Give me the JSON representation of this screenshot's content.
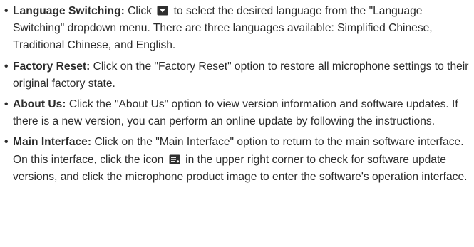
{
  "items": [
    {
      "term": "Language Switching:",
      "before_icon": "Click",
      "icon": "dropdown-square-icon",
      "after_icon": "to select the desired language from the \"Language Switching\" dropdown menu. There are three languages available: Simplified Chinese, Traditional Chinese, and English."
    },
    {
      "term": "Factory Reset:",
      "text": "Click on the \"Factory Reset\" option to restore all microphone settings to their original factory state."
    },
    {
      "term": "About Us:",
      "text": "Click the \"About Us\" option to view version information and software updates. If there is a new version, you can perform an online update by following the instructions."
    },
    {
      "term": "Main Interface:",
      "before_icon": "Click on the \"Main Interface\" option to return to the main software interface. On this interface, click the icon",
      "icon": "update-list-icon",
      "after_icon": "in the upper right corner to check for software update versions, and click the microphone product image to enter the software's operation interface."
    }
  ],
  "bullet": "•",
  "colors": {
    "text": "#2b2b2b",
    "icon": "#2f2f2f"
  }
}
